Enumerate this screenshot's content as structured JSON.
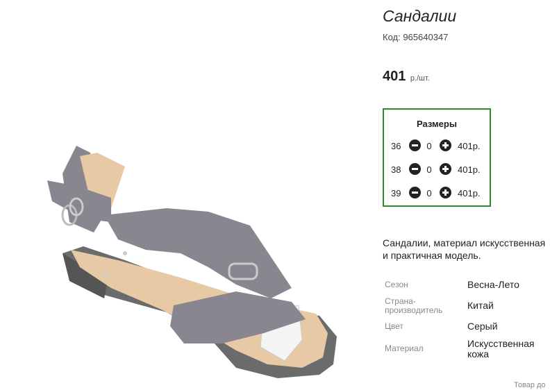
{
  "product": {
    "title": "Сандалии",
    "code": "Код: 965640347",
    "price_value": "401",
    "price_unit": "р./шт."
  },
  "sizes": {
    "title": "Размеры",
    "rows": [
      {
        "size": "36",
        "qty": "0",
        "price": "401р."
      },
      {
        "size": "38",
        "qty": "0",
        "price": "401р."
      },
      {
        "size": "39",
        "qty": "0",
        "price": "401р."
      }
    ]
  },
  "description": {
    "line1": "Сандалии, материал искусственная",
    "line2": "и практичная модель."
  },
  "attributes": [
    {
      "label": "Сезон",
      "value": "Весна-Лето"
    },
    {
      "label_line1": "Страна-",
      "label_line2": "производитель",
      "value": "Китай"
    },
    {
      "label": "Цвет",
      "value": "Серый"
    },
    {
      "label": "Материал",
      "value_line1": "Искусственная",
      "value_line2": "кожа"
    }
  ],
  "footer": {
    "cut_text": "Товар до"
  },
  "colors": {
    "border_green": "#2e8b2e",
    "leather_gray": "#8a8690",
    "sole_gray": "#6b6b6b",
    "insole": "#e8c9a6"
  },
  "icons": [
    "minus-icon",
    "plus-icon"
  ]
}
